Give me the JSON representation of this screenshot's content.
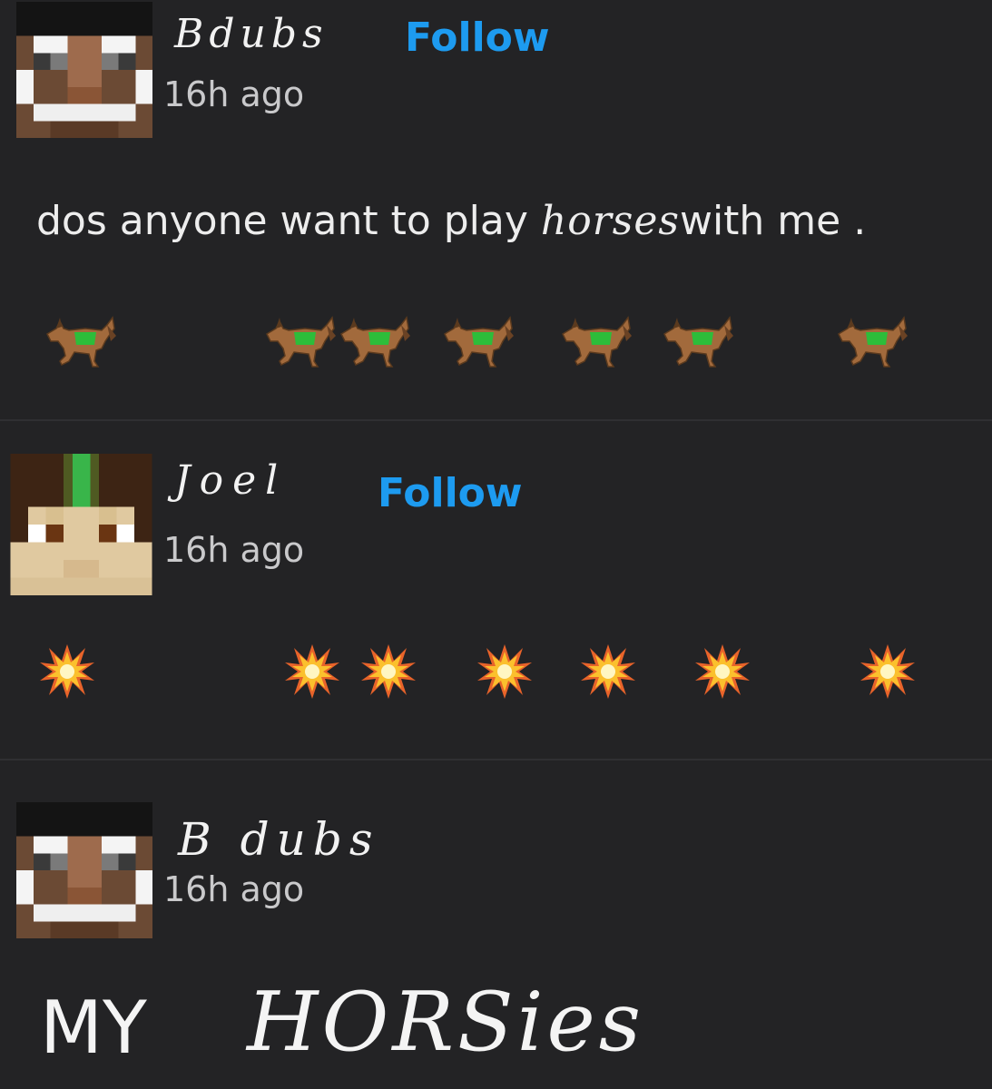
{
  "posts": [
    {
      "username": "Bdubs",
      "follow_label": "Follow",
      "time": "16h ago",
      "text_before": "dos anyone want to play ",
      "text_hand": "horses",
      "text_after": "with me .",
      "emoji_name": "horse",
      "emoji_count": 7
    },
    {
      "username": "Joel",
      "follow_label": "Follow",
      "time": "16h ago",
      "emoji_name": "collision",
      "emoji_count": 7
    },
    {
      "username": "B dubs",
      "time": "16h ago",
      "text_my": "MY",
      "text_horsies": "HORSies"
    }
  ],
  "colors": {
    "background": "#212123",
    "follow": "#1d9bf0",
    "text": "#ededed"
  },
  "icons": {
    "bdubs_avatar": "bdubs-minecraft-avatar",
    "joel_avatar": "joel-minecraft-avatar",
    "horse": "horse-emoji",
    "collision": "collision-emoji"
  }
}
